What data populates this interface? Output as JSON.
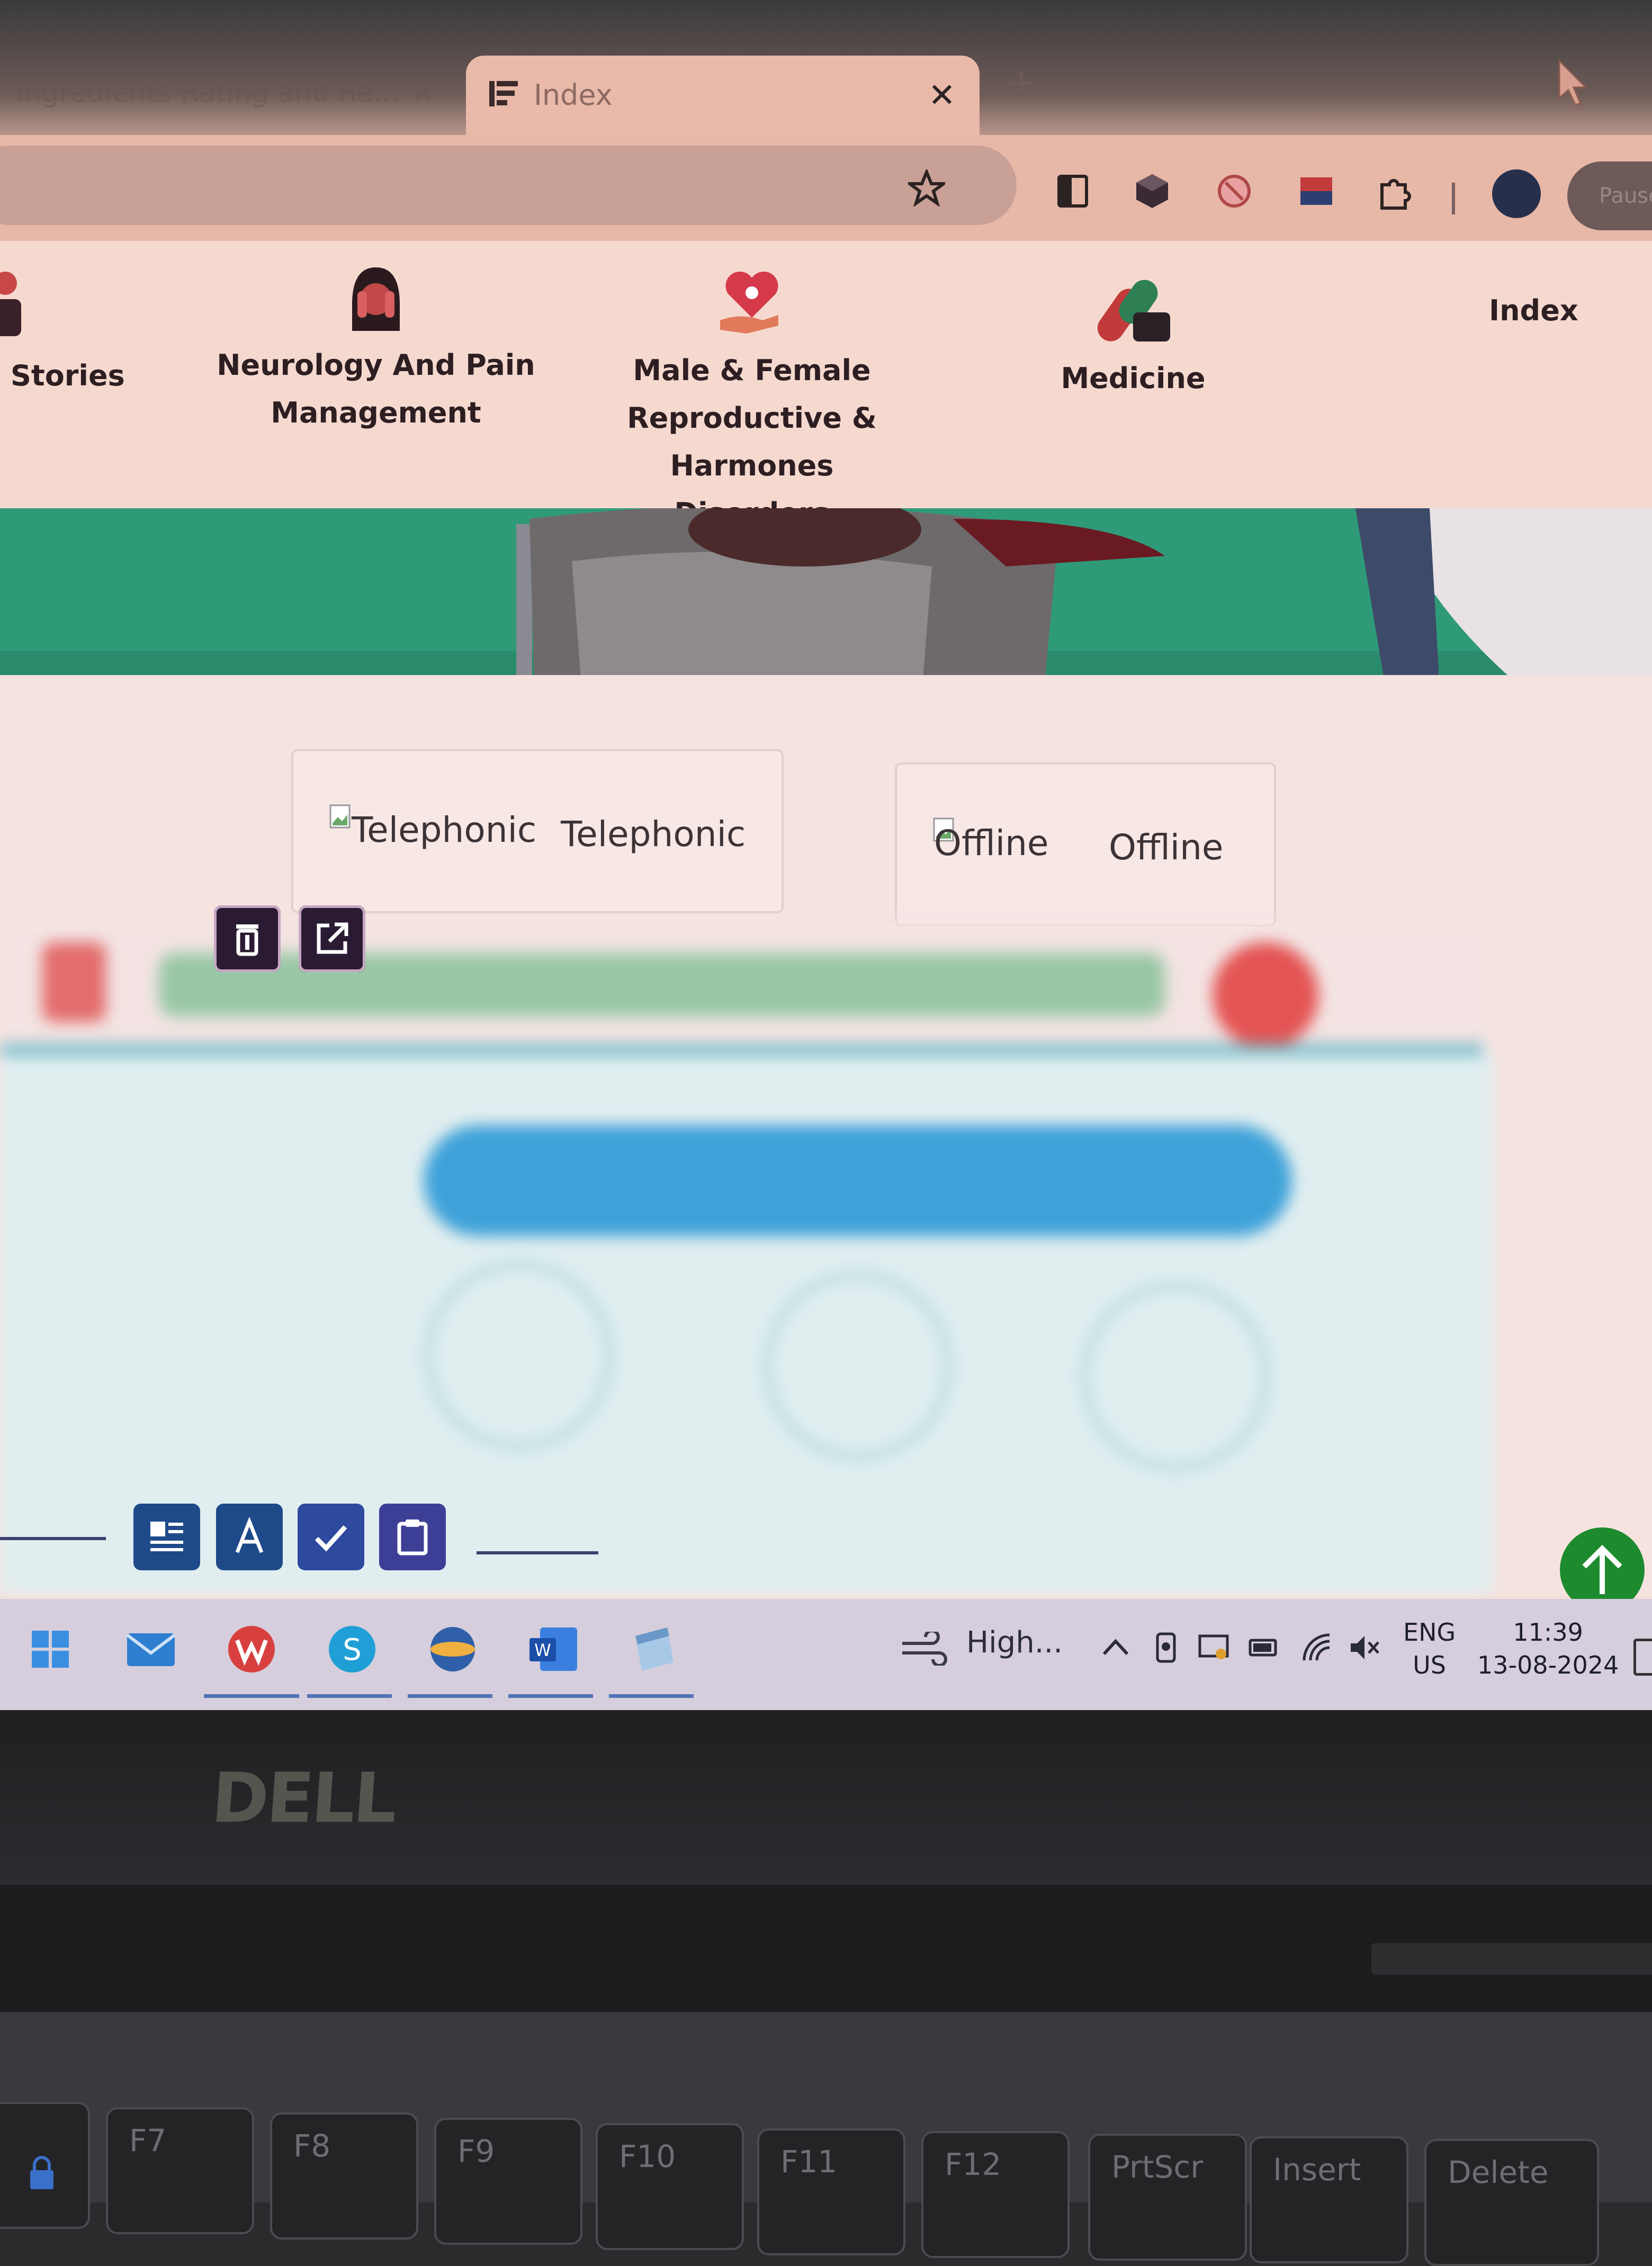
{
  "browser": {
    "tabs": [
      {
        "title": "Ingredients Rating and Re...",
        "active": false
      },
      {
        "title": "Index",
        "active": true
      }
    ],
    "new_tab_label": "+",
    "profile_button": "Paused",
    "extensions": [
      "reading-list-icon",
      "cube-extension-icon",
      "blocker-extension-icon",
      "wallet-extension-icon",
      "puzzle-extensions-icon"
    ]
  },
  "site_nav": {
    "items": [
      {
        "label": "Stories",
        "icon": "person-icon"
      },
      {
        "label_lines": [
          "Neurology And Pain",
          "Management"
        ],
        "icon": "head-pain-icon"
      },
      {
        "label_lines": [
          "Male & Female",
          "Reproductive &",
          "Harmones Disorders"
        ],
        "icon": "heart-hand-icon"
      },
      {
        "label": "Medicine",
        "icon": "pills-icon"
      }
    ],
    "index_link": "Index"
  },
  "consult_modes": [
    {
      "alt": "Telephonic",
      "label": "Telephonic"
    },
    {
      "alt": "Offline",
      "label": "Offline"
    }
  ],
  "editor_actions": [
    "delete-icon",
    "edit-icon"
  ],
  "mini_toolbar": [
    "layout-icon",
    "text-icon",
    "check-icon",
    "clipboard-icon"
  ],
  "taskbar": {
    "apps": [
      "start-icon",
      "mail-icon",
      "wps-office-icon",
      "skype-icon",
      "browser-icon",
      "word-icon",
      "notes-icon"
    ],
    "weather": "High...",
    "lang_top": "ENG",
    "lang_bottom": "US",
    "time": "11:39",
    "date": "13-08-2024"
  },
  "device": {
    "brand": "DELL",
    "keys": [
      "F7",
      "F8",
      "F9",
      "F10",
      "F11",
      "F12",
      "PrtScr",
      "Insert",
      "Delete"
    ]
  },
  "colors": {
    "scroll_top": "#1e8a2e",
    "action_button": "#2a1b33",
    "tool_blue": "#1f4a8a"
  }
}
